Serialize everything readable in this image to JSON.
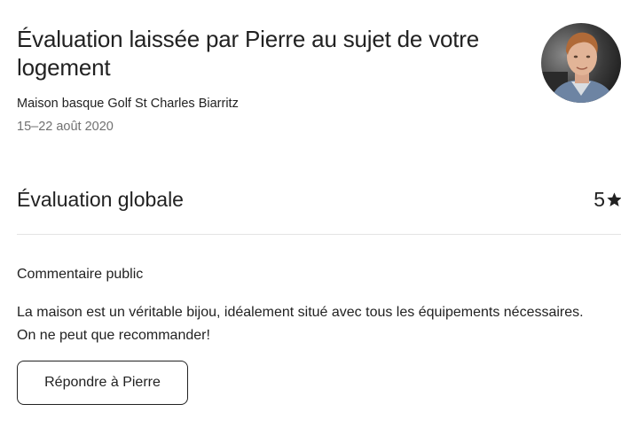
{
  "header": {
    "title": "Évaluation laissée par Pierre au sujet de votre logement",
    "listing_name": "Maison basque Golf St Charles Biarritz",
    "stay_dates": "15–22 août 2020"
  },
  "reviewer": {
    "avatar_icon": "avatar-photo"
  },
  "rating": {
    "label": "Évaluation globale",
    "value": "5",
    "icon": "star-icon"
  },
  "comment": {
    "heading": "Commentaire public",
    "text": "La maison est un véritable bijou, idéalement situé avec tous les équipements nécessaires. On ne peut que recommander!"
  },
  "actions": {
    "reply_label": "Répondre à Pierre"
  }
}
